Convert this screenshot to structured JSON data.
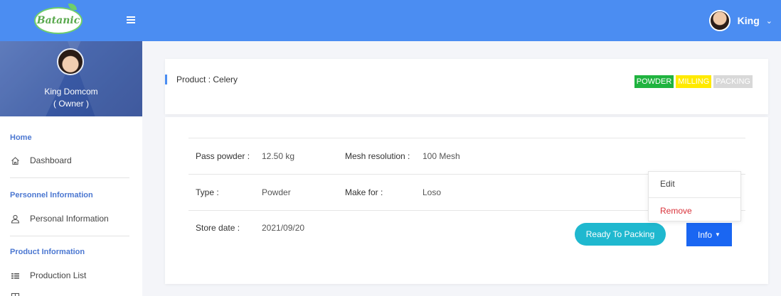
{
  "app": {
    "logo_text": "Batanic"
  },
  "topbar": {
    "user_name": "King"
  },
  "profile": {
    "name": "King Domcom",
    "role": "( Owner )"
  },
  "sidebar": {
    "sections": [
      {
        "label": "Home",
        "items": [
          {
            "label": "Dashboard",
            "icon": "home-icon"
          }
        ]
      },
      {
        "label": "Personnel Information",
        "items": [
          {
            "label": "Personal Information",
            "icon": "user-icon"
          }
        ]
      },
      {
        "label": "Product Information",
        "items": [
          {
            "label": "Production List",
            "icon": "list-icon"
          }
        ]
      }
    ]
  },
  "product": {
    "title": "Product : Celery",
    "badges": [
      {
        "label": "POWDER",
        "color": "#1fb33f"
      },
      {
        "label": "MILLING",
        "color": "#ffea00"
      },
      {
        "label": "PACKING",
        "color": "#d8d8d8"
      }
    ],
    "fields": {
      "pass_powder_label": "Pass powder :",
      "pass_powder_value": "12.50 kg",
      "mesh_label": "Mesh resolution :",
      "mesh_value": "100 Mesh",
      "type_label": "Type :",
      "type_value": "Powder",
      "make_for_label": "Make for :",
      "make_for_value": "Loso",
      "store_date_label": "Store date :",
      "store_date_value": "2021/09/20"
    },
    "actions": {
      "ready_label": "Ready To Packing",
      "info_label": "Info"
    },
    "dropdown": {
      "edit_label": "Edit",
      "remove_label": "Remove"
    }
  }
}
